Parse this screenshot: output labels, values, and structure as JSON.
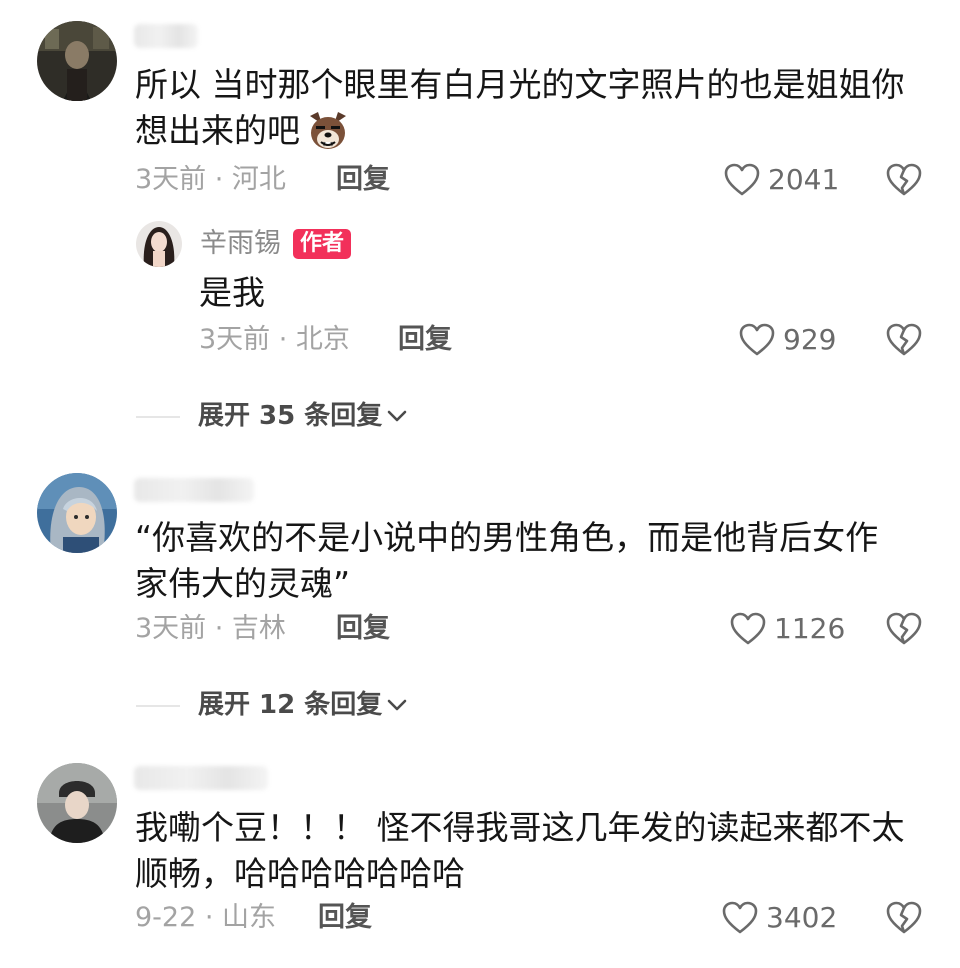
{
  "comments": [
    {
      "text_line1": "所以 当时那个眼里有白月光的文字照片的也是姐姐你",
      "text_line2": "想出来的吧",
      "meta": "3天前 · 河北",
      "reply_label": "回复",
      "likes": "2041",
      "reply": {
        "author": "辛雨锡",
        "badge": "作者",
        "text": "是我",
        "meta": "3天前 · 北京",
        "reply_label": "回复",
        "likes": "929"
      },
      "expand_label": "展开 35 条回复"
    },
    {
      "text_line1": "“你喜欢的不是小说中的男性角色，而是他背后女作",
      "text_line2": "家伟大的灵魂”",
      "meta": "3天前 · 吉林",
      "reply_label": "回复",
      "likes": "1126",
      "expand_label": "展开 12 条回复"
    },
    {
      "text_line1": "我嘞个豆！！！ 怪不得我哥这几年发的读起来都不太",
      "text_line2": "顺畅，哈哈哈哈哈哈哈",
      "meta": "9-22 · 山东",
      "reply_label": "回复",
      "likes": "3402"
    }
  ],
  "colors": {
    "badge": "#f2305a",
    "meta": "#a3a3a3",
    "text": "#161616"
  }
}
